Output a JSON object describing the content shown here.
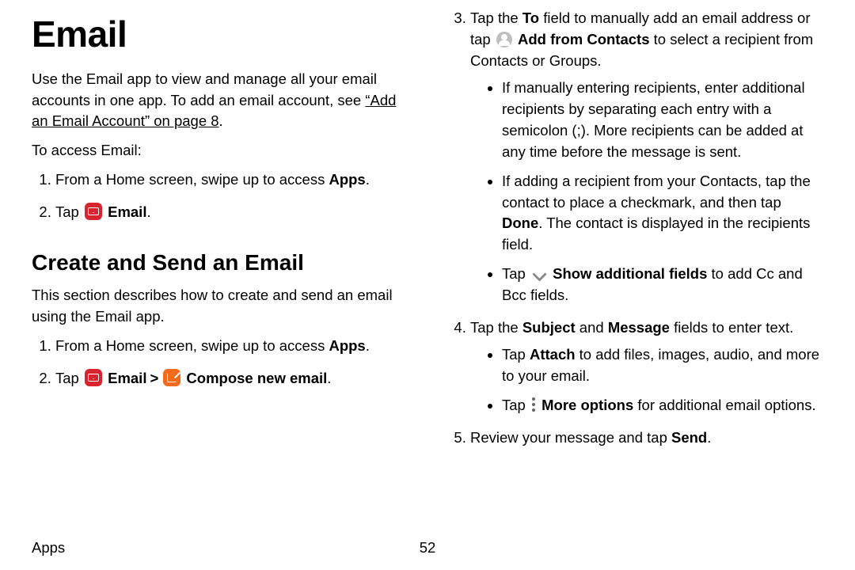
{
  "h1": "Email",
  "intro_a": "Use the Email app to view and manage all your email accounts in one app. To add an email account, see ",
  "intro_link": "“Add an Email Account” on page 8",
  "intro_c": ".",
  "to_access": "To access Email:",
  "step1_a": "From a Home screen, swipe up to access ",
  "apps_b": "Apps",
  "period": ".",
  "tap": "Tap ",
  "email_b": "Email",
  "h2": "Create and Send an Email",
  "sec_intro": "This section describes how to create and send an email using the Email app.",
  "compose_b": "Compose new email",
  "s3_a": "Tap the ",
  "to_b": "To",
  "s3_b": " field to manually add an email address or tap ",
  "addfrom_b": "Add from Contacts",
  "s3_c": " to select a recipient from Contacts or Groups.",
  "s3_bul1": "If manually entering recipients, enter additional recipients by separating each entry with a semicolon (;). More recipients can be added at any time before the message is sent.",
  "s3_bul2_a": "If adding a recipient from your Contacts, tap the contact to place a checkmark, and then tap ",
  "done_b": "Done",
  "s3_bul2_b": ". The contact is displayed in the recipients field.",
  "s3_bul3_a": "Tap ",
  "showadd_b": "Show additional fields",
  "s3_bul3_b": " to add Cc and Bcc fields.",
  "s4_a": "Tap the ",
  "subject_b": "Subject",
  "and": " and ",
  "message_b": "Message",
  "s4_b": " fields to enter text.",
  "s4_bul1_a": "Tap ",
  "attach_b": "Attach",
  "s4_bul1_b": " to add files, images, audio, and more to your email.",
  "s4_bul2_a": "Tap ",
  "moreopt_b": "More options",
  "s4_bul2_b": " for additional email options.",
  "s5_a": "Review your message and tap ",
  "send_b": "Send",
  "footer_section": "Apps",
  "page_number": "52",
  "chev": ">"
}
